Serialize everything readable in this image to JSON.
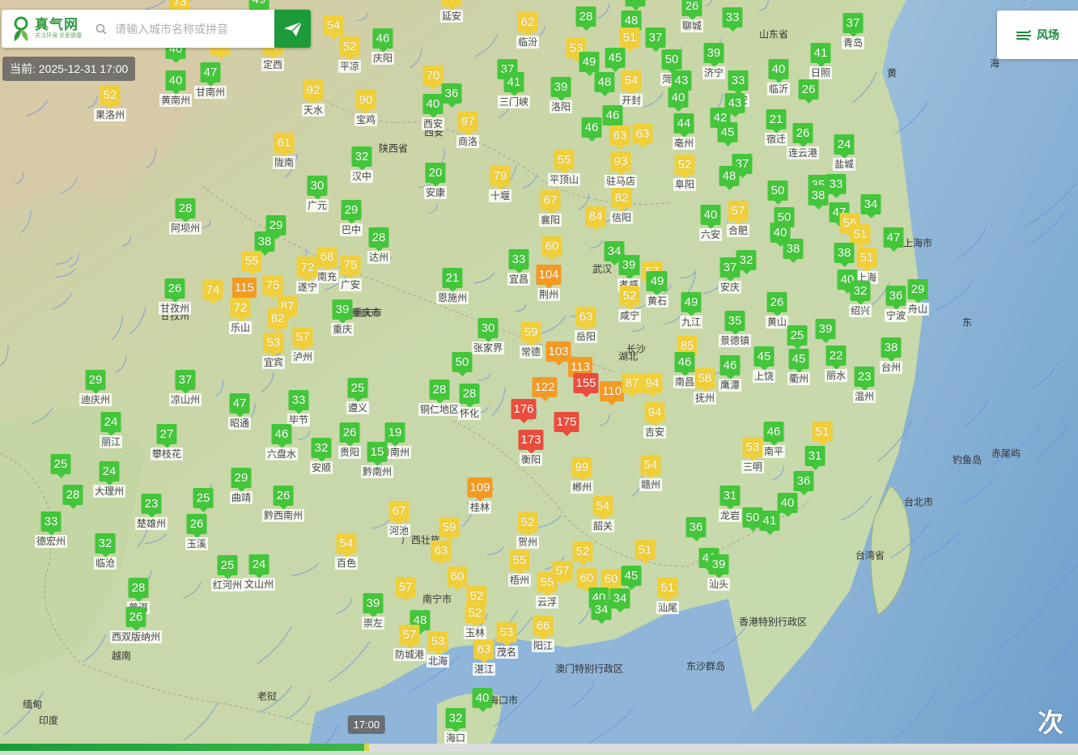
{
  "brand": {
    "name": "真气网",
    "slogan": "关注环境 关爱健康"
  },
  "search": {
    "placeholder": "请输入城市名称或拼音"
  },
  "current_time": "当前: 2025-12-31 17:00",
  "wind_button": {
    "label": "风场"
  },
  "timeline": {
    "time_label": "17:00",
    "progress": 0.34
  },
  "corner_text": "次",
  "colors": {
    "good": "#43c63a",
    "moderate": "#f0cf3a",
    "light": "#f39a23",
    "moderate_pollution": "#ea4d3c",
    "brand": "#1d9b3b"
  },
  "cities": [
    {
      "name": "",
      "aqi": 73
    },
    {
      "name": "",
      "aqi": 49
    },
    {
      "name": "延安",
      "aqi": 53
    },
    {
      "name": "",
      "aqi": 50
    },
    {
      "name": "聊城",
      "aqi": 26
    },
    {
      "name": "",
      "aqi": 33
    },
    {
      "name": "",
      "aqi": 40
    },
    {
      "name": "",
      "aqi": 74
    },
    {
      "name": "定西",
      "aqi": 73
    },
    {
      "name": "",
      "aqi": 54
    },
    {
      "name": "平凉",
      "aqi": 52
    },
    {
      "name": "庆阳",
      "aqi": 46
    },
    {
      "name": "临汾",
      "aqi": 62
    },
    {
      "name": "",
      "aqi": 28
    },
    {
      "name": "",
      "aqi": 48
    },
    {
      "name": "",
      "aqi": 53
    },
    {
      "name": "",
      "aqi": 51
    },
    {
      "name": "",
      "aqi": 37
    },
    {
      "name": "",
      "aqi": 49
    },
    {
      "name": "",
      "aqi": 45
    },
    {
      "name": "菏泽",
      "aqi": 50
    },
    {
      "name": "济宁",
      "aqi": 39
    },
    {
      "name": "泰安",
      "aqi": 33
    },
    {
      "name": "青岛",
      "aqi": 37
    },
    {
      "name": "日照",
      "aqi": 41
    },
    {
      "name": "黄南州",
      "aqi": 40
    },
    {
      "name": "甘南州",
      "aqi": 47
    },
    {
      "name": "",
      "aqi": 70
    },
    {
      "name": "",
      "aqi": 37
    },
    {
      "name": "三门峡",
      "aqi": 41
    },
    {
      "name": "洛阳",
      "aqi": 39
    },
    {
      "name": "",
      "aqi": 48
    },
    {
      "name": "开封",
      "aqi": 54
    },
    {
      "name": "",
      "aqi": 43
    },
    {
      "name": "临沂",
      "aqi": 40
    },
    {
      "name": "",
      "aqi": 26
    },
    {
      "name": "果洛州",
      "aqi": 52
    },
    {
      "name": "天水",
      "aqi": 92
    },
    {
      "name": "宝鸡",
      "aqi": 90
    },
    {
      "name": "西安",
      "aqi": 40
    },
    {
      "name": "",
      "aqi": 36
    },
    {
      "name": "商洛",
      "aqi": 97
    },
    {
      "name": "",
      "aqi": 46
    },
    {
      "name": "",
      "aqi": 46
    },
    {
      "name": "",
      "aqi": 63
    },
    {
      "name": "",
      "aqi": 63
    },
    {
      "name": "",
      "aqi": 40
    },
    {
      "name": "亳州",
      "aqi": 44
    },
    {
      "name": "",
      "aqi": 42
    },
    {
      "name": "",
      "aqi": 43
    },
    {
      "name": "宿迁",
      "aqi": 21
    },
    {
      "name": "连云港",
      "aqi": 26
    },
    {
      "name": "",
      "aqi": 45
    },
    {
      "name": "淮安",
      "aqi": 26
    },
    {
      "name": "陇南",
      "aqi": 61
    },
    {
      "name": "汉中",
      "aqi": 32
    },
    {
      "name": "平顶山",
      "aqi": 55
    },
    {
      "name": "驻马店",
      "aqi": 93
    },
    {
      "name": "阜阳",
      "aqi": 52
    },
    {
      "name": "",
      "aqi": 37
    },
    {
      "name": "盐城",
      "aqi": 24
    },
    {
      "name": "安康",
      "aqi": 20
    },
    {
      "name": "十堰",
      "aqi": 79
    },
    {
      "name": "",
      "aqi": 48
    },
    {
      "name": "",
      "aqi": 50
    },
    {
      "name": "",
      "aqi": 35
    },
    {
      "name": "",
      "aqi": 33
    },
    {
      "name": "广元",
      "aqi": 30
    },
    {
      "name": "巴中",
      "aqi": 29
    },
    {
      "name": "襄阳",
      "aqi": 67
    },
    {
      "name": "信阳",
      "aqi": 82
    },
    {
      "name": "",
      "aqi": 84
    },
    {
      "name": "",
      "aqi": 38
    },
    {
      "name": "",
      "aqi": 47
    },
    {
      "name": "阿坝州",
      "aqi": 28
    },
    {
      "name": "",
      "aqi": 29
    },
    {
      "name": "",
      "aqi": 38
    },
    {
      "name": "达州",
      "aqi": 28
    },
    {
      "name": "六安",
      "aqi": 40
    },
    {
      "name": "合肥",
      "aqi": 57
    },
    {
      "name": "",
      "aqi": 50
    },
    {
      "name": "",
      "aqi": 56
    },
    {
      "name": "",
      "aqi": 34
    },
    {
      "name": "",
      "aqi": 51
    },
    {
      "name": "",
      "aqi": 55
    },
    {
      "name": "",
      "aqi": 72
    },
    {
      "name": "南充",
      "aqi": 68
    },
    {
      "name": "广安",
      "aqi": 75
    },
    {
      "name": "宜昌",
      "aqi": 33
    },
    {
      "name": "",
      "aqi": 60
    },
    {
      "name": "",
      "aqi": 34
    },
    {
      "name": "",
      "aqi": 44
    },
    {
      "name": "",
      "aqi": 40
    },
    {
      "name": "",
      "aqi": 38
    },
    {
      "name": "",
      "aqi": 38
    },
    {
      "name": "上海",
      "aqi": 51
    },
    {
      "name": "",
      "aqi": 47
    },
    {
      "name": "甘孜州",
      "aqi": 26
    },
    {
      "name": "",
      "aqi": 74
    },
    {
      "name": "",
      "aqi": 115
    },
    {
      "name": "",
      "aqi": 75
    },
    {
      "name": "遂宁",
      "aqi": 72
    },
    {
      "name": "恩施州",
      "aqi": 21
    },
    {
      "name": "荆州",
      "aqi": 104
    },
    {
      "name": "孝感",
      "aqi": 39
    },
    {
      "name": "",
      "aqi": 57
    },
    {
      "name": "",
      "aqi": 49
    },
    {
      "name": "安庆",
      "aqi": 37
    },
    {
      "name": "",
      "aqi": 32
    },
    {
      "name": "",
      "aqi": 40
    },
    {
      "name": "绍兴",
      "aqi": 32
    },
    {
      "name": "宁波",
      "aqi": 36
    },
    {
      "name": "舟山",
      "aqi": 29
    },
    {
      "name": "雅安",
      "aqi": 72
    },
    {
      "name": "",
      "aqi": 87
    },
    {
      "name": "",
      "aqi": 82
    },
    {
      "name": "重庆",
      "aqi": 39
    },
    {
      "name": "咸宁",
      "aqi": 52
    },
    {
      "name": "黄石",
      "aqi": 49
    },
    {
      "name": "九江",
      "aqi": 49
    },
    {
      "name": "黄山",
      "aqi": 26
    },
    {
      "name": "乐山",
      "aqi": 72
    },
    {
      "name": "泸州",
      "aqi": 57
    },
    {
      "name": "张家界",
      "aqi": 30
    },
    {
      "name": "常德",
      "aqi": 59
    },
    {
      "name": "岳阳",
      "aqi": 63
    },
    {
      "name": "景德镇",
      "aqi": 35
    },
    {
      "name": "",
      "aqi": 25
    },
    {
      "name": "",
      "aqi": 39
    },
    {
      "name": "宜宾",
      "aqi": 53
    },
    {
      "name": "",
      "aqi": 103
    },
    {
      "name": "",
      "aqi": 85
    },
    {
      "name": "衢州",
      "aqi": 45
    },
    {
      "name": "丽水",
      "aqi": 22
    },
    {
      "name": "台州",
      "aqi": 38
    },
    {
      "name": "",
      "aqi": 50
    },
    {
      "name": "",
      "aqi": 113
    },
    {
      "name": "南昌",
      "aqi": 46
    },
    {
      "name": "上饶",
      "aqi": 45
    },
    {
      "name": "迪庆州",
      "aqi": 29
    },
    {
      "name": "凉山州",
      "aqi": 37
    },
    {
      "name": "",
      "aqi": 122
    },
    {
      "name": "",
      "aqi": 155
    },
    {
      "name": "",
      "aqi": 110
    },
    {
      "name": "",
      "aqi": 87
    },
    {
      "name": "",
      "aqi": 94
    },
    {
      "name": "抚州",
      "aqi": 58
    },
    {
      "name": "鹰潭",
      "aqi": 46
    },
    {
      "name": "温州",
      "aqi": 23
    },
    {
      "name": "遵义",
      "aqi": 25
    },
    {
      "name": "铜仁地区",
      "aqi": 28
    },
    {
      "name": "怀化",
      "aqi": 28
    },
    {
      "name": "昭通",
      "aqi": 47
    },
    {
      "name": "毕节",
      "aqi": 33
    },
    {
      "name": "",
      "aqi": 176
    },
    {
      "name": "",
      "aqi": 175
    },
    {
      "name": "吉安",
      "aqi": 94
    },
    {
      "name": "丽江",
      "aqi": 24
    },
    {
      "name": "攀枝花",
      "aqi": 27
    },
    {
      "name": "六盘水",
      "aqi": 46
    },
    {
      "name": "贵阳",
      "aqi": 26
    },
    {
      "name": "黔南州",
      "aqi": 19
    },
    {
      "name": "衡阳",
      "aqi": 173
    },
    {
      "name": "南平",
      "aqi": 46
    },
    {
      "name": "",
      "aqi": 51
    },
    {
      "name": "安顺",
      "aqi": 32
    },
    {
      "name": "黔南州",
      "aqi": 15
    },
    {
      "name": "",
      "aqi": 25
    },
    {
      "name": "大理州",
      "aqi": 24
    },
    {
      "name": "郴州",
      "aqi": 99
    },
    {
      "name": "赣州",
      "aqi": 54
    },
    {
      "name": "三明",
      "aqi": 53
    },
    {
      "name": "",
      "aqi": 31
    },
    {
      "name": "",
      "aqi": 28
    },
    {
      "name": "曲靖",
      "aqi": 29
    },
    {
      "name": "桂林",
      "aqi": 109
    },
    {
      "name": "",
      "aqi": 25
    },
    {
      "name": "黔西南州",
      "aqi": 26
    },
    {
      "name": "",
      "aqi": 36
    },
    {
      "name": "德宏州",
      "aqi": 33
    },
    {
      "name": "楚雄州",
      "aqi": 23
    },
    {
      "name": "河池",
      "aqi": 67
    },
    {
      "name": "韶关",
      "aqi": 54
    },
    {
      "name": "龙岩",
      "aqi": 31
    },
    {
      "name": "",
      "aqi": 40
    },
    {
      "name": "玉溪",
      "aqi": 26
    },
    {
      "name": "",
      "aqi": 59
    },
    {
      "name": "贺州",
      "aqi": 52
    },
    {
      "name": "",
      "aqi": 36
    },
    {
      "name": "",
      "aqi": 50
    },
    {
      "name": "",
      "aqi": 41
    },
    {
      "name": "临沧",
      "aqi": 32
    },
    {
      "name": "百色",
      "aqi": 54
    },
    {
      "name": "",
      "aqi": 63
    },
    {
      "name": "",
      "aqi": 52
    },
    {
      "name": "",
      "aqi": 51
    },
    {
      "name": "红河州",
      "aqi": 25
    },
    {
      "name": "文山州",
      "aqi": 24
    },
    {
      "name": "梧州",
      "aqi": 55
    },
    {
      "name": "",
      "aqi": 42
    },
    {
      "name": "汕头",
      "aqi": 39
    },
    {
      "name": "",
      "aqi": 57
    },
    {
      "name": "",
      "aqi": 60
    },
    {
      "name": "云浮",
      "aqi": 55
    },
    {
      "name": "",
      "aqi": 57
    },
    {
      "name": "",
      "aqi": 60
    },
    {
      "name": "",
      "aqi": 60
    },
    {
      "name": "",
      "aqi": 45
    },
    {
      "name": "普洱",
      "aqi": 28
    },
    {
      "name": "",
      "aqi": 52
    },
    {
      "name": "玉林",
      "aqi": 52
    },
    {
      "name": "",
      "aqi": 40
    },
    {
      "name": "",
      "aqi": 34
    },
    {
      "name": "汕尾",
      "aqi": 51
    },
    {
      "name": "崇左",
      "aqi": 39
    },
    {
      "name": "",
      "aqi": 48
    },
    {
      "name": "",
      "aqi": 34
    },
    {
      "name": "西双版纳州",
      "aqi": 26
    },
    {
      "name": "阳江",
      "aqi": 66
    },
    {
      "name": "防城港",
      "aqi": 57
    },
    {
      "name": "北海",
      "aqi": 53
    },
    {
      "name": "茂名",
      "aqi": 53
    },
    {
      "name": "湛江",
      "aqi": 63
    },
    {
      "name": "",
      "aqi": 40
    },
    {
      "name": "海口",
      "aqi": 32
    }
  ],
  "place_names": [
    "甘孜州",
    "西安",
    "武汉",
    "长沙",
    "重庆市",
    "上海市",
    "台北市",
    "台湾省",
    "香港特别行政区",
    "澳门特别行政区",
    "东沙群岛",
    "山东省",
    "陕西省",
    "重庆市",
    "湖北",
    "南宁市",
    "广西壮族",
    "海口市",
    "缅甸",
    "老挝",
    "越南",
    "印度",
    "钓鱼岛",
    "赤尾屿",
    "黄",
    "海",
    "东"
  ]
}
